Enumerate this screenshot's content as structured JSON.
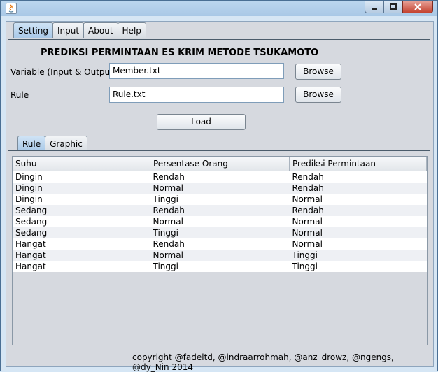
{
  "window": {
    "title": ""
  },
  "menu_tabs": [
    {
      "label": "Setting",
      "active": true
    },
    {
      "label": "Input",
      "active": false
    },
    {
      "label": "About",
      "active": false
    },
    {
      "label": "Help",
      "active": false
    }
  ],
  "heading": "PREDIKSI PERMINTAAN ES KRIM METODE TSUKAMOTO",
  "variable": {
    "label": "Variable (Input & Output)",
    "value": "Member.txt",
    "browse": "Browse"
  },
  "rule": {
    "label": "Rule",
    "value": "Rule.txt",
    "browse": "Browse"
  },
  "load_button": "Load",
  "inner_tabs": [
    {
      "label": "Rule",
      "active": true
    },
    {
      "label": "Graphic",
      "active": false
    }
  ],
  "table": {
    "columns": [
      "Suhu",
      "Persentase Orang",
      "Prediksi Permintaan"
    ],
    "rows": [
      [
        "Dingin",
        "Rendah",
        "Rendah"
      ],
      [
        "Dingin",
        "Normal",
        "Rendah"
      ],
      [
        "Dingin",
        "Tinggi",
        "Normal"
      ],
      [
        "Sedang",
        "Rendah",
        "Rendah"
      ],
      [
        "Sedang",
        "Normal",
        "Normal"
      ],
      [
        "Sedang",
        "Tinggi",
        "Normal"
      ],
      [
        "Hangat",
        "Rendah",
        "Normal"
      ],
      [
        "Hangat",
        "Normal",
        "Tinggi"
      ],
      [
        "Hangat",
        "Tinggi",
        "Tinggi"
      ]
    ]
  },
  "footer": "copyright @fadeltd, @indraarrohmah, @anz_drowz, @ngengs, @dy_Nin 2014"
}
